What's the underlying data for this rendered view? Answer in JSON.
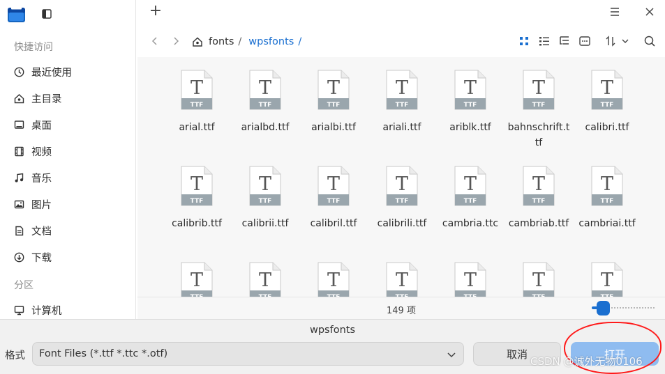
{
  "window": {
    "add_tab_glyph": "+"
  },
  "sidebar": {
    "section_quick": "快捷访问",
    "section_partition": "分区",
    "items": [
      {
        "label": "最近使用",
        "icon": "clock-icon"
      },
      {
        "label": "主目录",
        "icon": "home-icon"
      },
      {
        "label": "桌面",
        "icon": "desktop-icon"
      },
      {
        "label": "视频",
        "icon": "video-icon"
      },
      {
        "label": "音乐",
        "icon": "music-icon"
      },
      {
        "label": "图片",
        "icon": "picture-icon"
      },
      {
        "label": "文档",
        "icon": "document-icon"
      },
      {
        "label": "下载",
        "icon": "download-icon"
      },
      {
        "label": "计算机",
        "icon": "computer-icon"
      }
    ]
  },
  "breadcrumb": {
    "items": [
      "fonts",
      "wpsfonts"
    ],
    "separator": "/"
  },
  "files": [
    {
      "name": "arial.ttf"
    },
    {
      "name": "arialbd.ttf"
    },
    {
      "name": "arialbi.ttf"
    },
    {
      "name": "ariali.ttf"
    },
    {
      "name": "ariblk.ttf"
    },
    {
      "name": "bahnschrift.ttf"
    },
    {
      "name": "calibri.ttf"
    },
    {
      "name": "calibrib.ttf"
    },
    {
      "name": "calibrii.ttf"
    },
    {
      "name": "calibril.ttf"
    },
    {
      "name": "calibrili.ttf"
    },
    {
      "name": "cambria.ttc"
    },
    {
      "name": "cambriab.ttf"
    },
    {
      "name": "cambriai.ttf"
    },
    {
      "name": ""
    },
    {
      "name": ""
    },
    {
      "name": ""
    },
    {
      "name": ""
    },
    {
      "name": ""
    },
    {
      "name": ""
    },
    {
      "name": ""
    }
  ],
  "file_icon": {
    "letter": "T",
    "badge": "TTF"
  },
  "status": {
    "count": "149 项",
    "zoom_level": 0.1
  },
  "dialog": {
    "filename": "wpsfonts",
    "format_label": "格式",
    "format_value": "Font Files (*.ttf *.ttc *.otf)",
    "cancel_label": "取消",
    "open_label": "打开"
  },
  "watermark": "CSDN @诚外无物0106",
  "colors": {
    "accent": "#1a6fd0",
    "open_button": "#8fbcf0",
    "annotation": "#ff1a1a"
  }
}
